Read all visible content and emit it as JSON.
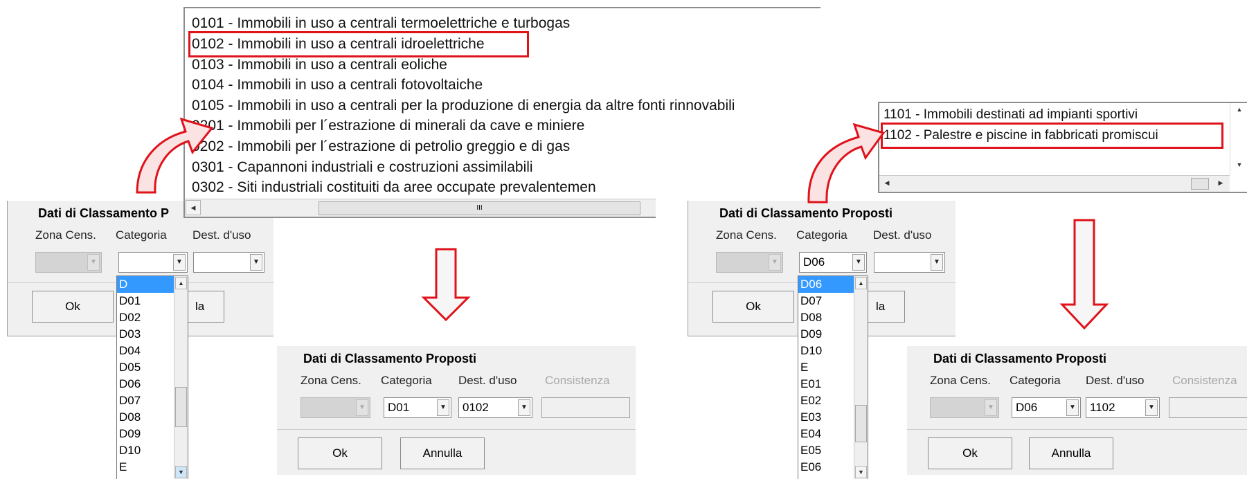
{
  "colors": {
    "highlight_red": "#e0121a",
    "selection_blue": "#3399ff",
    "panel_bg": "#f0f0f0"
  },
  "left": {
    "popup_list": {
      "items": [
        "0101 - Immobili in uso a centrali termoelettriche e turbogas",
        "0102 - Immobili in uso a centrali idroelettriche",
        "0103 - Immobili in uso a centrali eoliche",
        "0104 - Immobili in uso a centrali fotovoltaiche",
        "0105 - Immobili in uso a centrali per la produzione di energia da altre fonti rinnovabili",
        "0201 - Immobili per l´estrazione di minerali da cave e miniere",
        "0202 - Immobili per l´estrazione di petrolio greggio e di gas",
        "0301 - Capannoni industriali e costruzioni assimilabili",
        "0302 - Siti industriali costituiti da aree occupate prevalentemen"
      ],
      "scroll_grip": "III"
    },
    "dialog_before": {
      "title": "Dati di Classamento P",
      "zona_label": "Zona Cens.",
      "categoria_label": "Categoria",
      "dest_label": "Dest. d'uso",
      "categoria_value": "",
      "dest_value": "",
      "ok_label": "Ok",
      "annulla_partial": "la"
    },
    "categoria_dropdown": {
      "items": [
        "D",
        "D01",
        "D02",
        "D03",
        "D04",
        "D05",
        "D06",
        "D07",
        "D08",
        "D09",
        "D10",
        "E"
      ]
    },
    "dialog_after": {
      "title": "Dati di Classamento Proposti",
      "zona_label": "Zona Cens.",
      "categoria_label": "Categoria",
      "dest_label": "Dest. d'uso",
      "consistenza_label": "Consistenza",
      "categoria_value": "D01",
      "dest_value": "0102",
      "ok_label": "Ok",
      "annulla_label": "Annulla"
    }
  },
  "right": {
    "popup_list": {
      "items": [
        "1101 - Immobili destinati ad impianti sportivi",
        "1102 - Palestre e piscine in fabbricati promiscui"
      ]
    },
    "dialog_before": {
      "title": "Dati di Classamento Proposti",
      "zona_label": "Zona Cens.",
      "categoria_label": "Categoria",
      "dest_label": "Dest. d'uso",
      "categoria_value": "D06",
      "dest_value": "",
      "ok_label": "Ok",
      "annulla_partial": "la"
    },
    "categoria_dropdown": {
      "items": [
        "D06",
        "D07",
        "D08",
        "D09",
        "D10",
        "E",
        "E01",
        "E02",
        "E03",
        "E04",
        "E05",
        "E06"
      ]
    },
    "dialog_after": {
      "title": "Dati di Classamento Proposti",
      "zona_label": "Zona Cens.",
      "categoria_label": "Categoria",
      "dest_label": "Dest. d'uso",
      "consistenza_label": "Consistenza",
      "categoria_value": "D06",
      "dest_value": "1102",
      "ok_label": "Ok",
      "annulla_label": "Annulla"
    }
  }
}
